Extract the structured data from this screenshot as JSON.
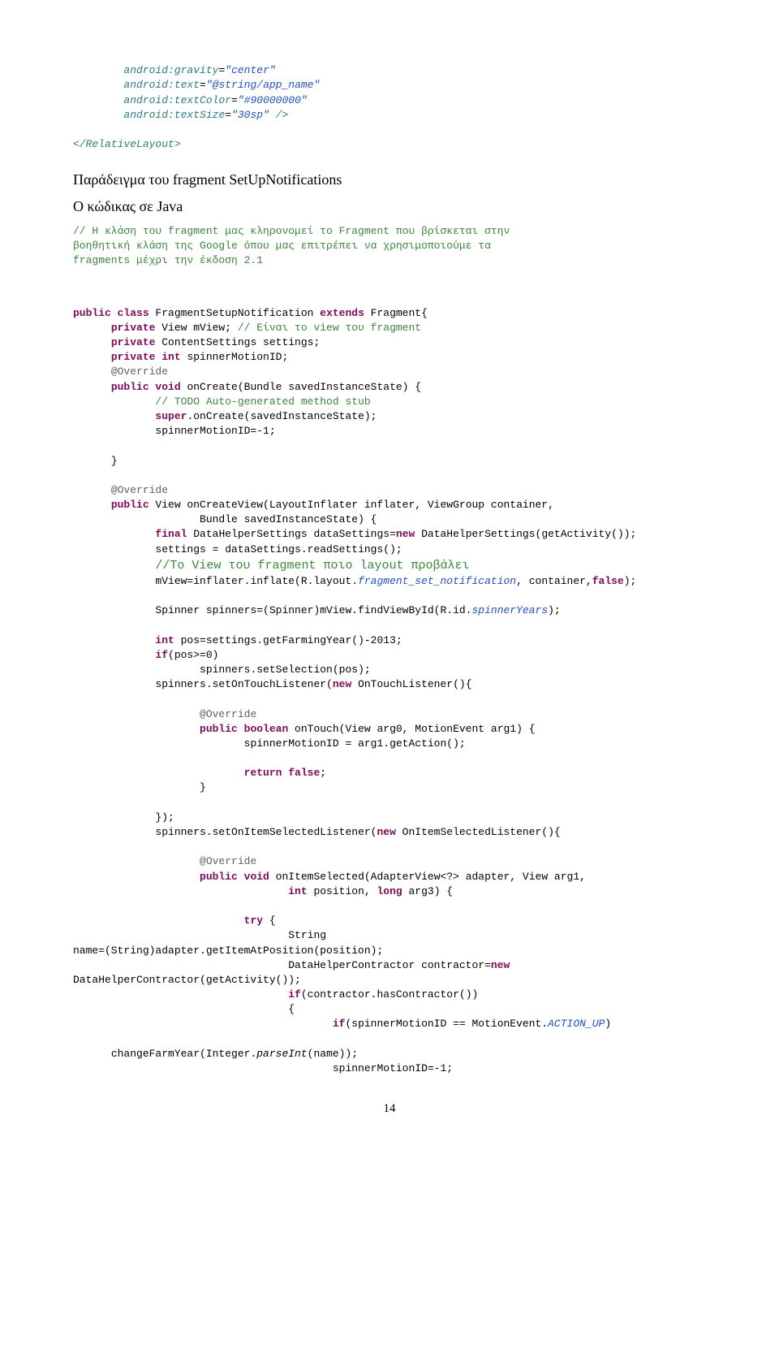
{
  "xml": {
    "l1a": "android:gravity",
    "l1b": "=",
    "l1c": "\"center\"",
    "l2a": "android:text",
    "l2b": "=",
    "l2c": "\"@string/app_name\"",
    "l3a": "android:textColor",
    "l3b": "=",
    "l3c": "\"#90000000\"",
    "l4a": "android:textSize",
    "l4b": "=",
    "l4c": "\"30sp\"",
    "l4d": " />",
    "close": "</",
    "closeTag": "RelativeLayout",
    "closeEnd": ">"
  },
  "heading1": "Παράδειγμα του fragment SetUpNotifications",
  "heading2": "Ο κώδικας σε Java",
  "topcomment": "// Η κλάση του fragment μας κληρονομεί το Fragment που βρίσκεται στην\nβοηθητική κλάση της Google όπου μας επιτρέπει να χρησιμοποιούμε τα\nfragments μέχρι την έκδοση 2.1",
  "c": {
    "l1": "public class FragmentSetupNotification extends Fragment{",
    "l2a": "private",
    "l2b": " View mView; ",
    "l2c": "// Είναι το view του fragment",
    "l3a": "private",
    "l3b": " ContentSettings settings;",
    "l4a": "private int",
    "l4b": " spinnerMotionID;",
    "l5": "@Override",
    "l6a": "public void",
    "l6b": " onCreate(Bundle savedInstanceState) {",
    "l7": "// TODO Auto-generated method stub",
    "l8a": "super",
    "l8b": ".onCreate(savedInstanceState);",
    "l9": "spinnerMotionID=-1;",
    "l10": "}",
    "l11": "@Override",
    "l12a": "public",
    "l12b": " View onCreateView(LayoutInflater inflater, ViewGroup container,",
    "l13": "Bundle savedInstanceState) {",
    "l14a": "final",
    "l14b": " DataHelperSettings dataSettings=",
    "l14c": "new",
    "l14d": " DataHelperSettings(getActivity());",
    "l15": "settings = dataSettings.readSettings();",
    "l16": "//Το View του fragment ποιο layout προβάλει",
    "l17a": "mView=inflater.inflate(R.layout.",
    "l17b": "fragment_set_notification",
    "l17c": ", container,",
    "l17d": "false",
    "l17e": ");",
    "l18a": "Spinner spinners=(Spinner)mView.findViewById(R.id.",
    "l18b": "spinnerYears",
    "l18c": ");",
    "l19a": "int",
    "l19b": " pos=settings.getFarmingYear()-2013;",
    "l20a": "if",
    "l20b": "(pos>=0)",
    "l21": "spinners.setSelection(pos);",
    "l22a": "spinners.setOnTouchListener(",
    "l22b": "new",
    "l22c": " OnTouchListener(){",
    "l23": "@Override",
    "l24a": "public boolean",
    "l24b": " onTouch(View arg0, MotionEvent arg1) {",
    "l25": "spinnerMotionID = arg1.getAction();",
    "l26a": "return false",
    "l26b": ";",
    "l27": "}",
    "l28": "});",
    "l29a": "spinners.setOnItemSelectedListener(",
    "l29b": "new",
    "l29c": " OnItemSelectedListener(){",
    "l30": "@Override",
    "l31a": "public void",
    "l31b": " onItemSelected(AdapterView<?> adapter, View arg1,",
    "l32a": "int",
    "l32b": " position, ",
    "l32c": "long",
    "l32d": " arg3) {",
    "l33a": "try",
    "l33b": " {",
    "l34": "String",
    "l35": "name=(String)adapter.getItemAtPosition(position);",
    "l36a": "DataHelperContractor contractor=",
    "l36b": "new",
    "l37": "DataHelperContractor(getActivity());",
    "l38a": "if",
    "l38b": "(contractor.hasContractor())",
    "l39": "{",
    "l40a": "if",
    "l40b": "(spinnerMotionID == MotionEvent.",
    "l40c": "ACTION_UP",
    "l40d": ")",
    "l41a": "changeFarmYear(Integer.",
    "l41b": "parseInt",
    "l41c": "(name));",
    "l42": "spinnerMotionID=-1;"
  },
  "pageNum": "14"
}
